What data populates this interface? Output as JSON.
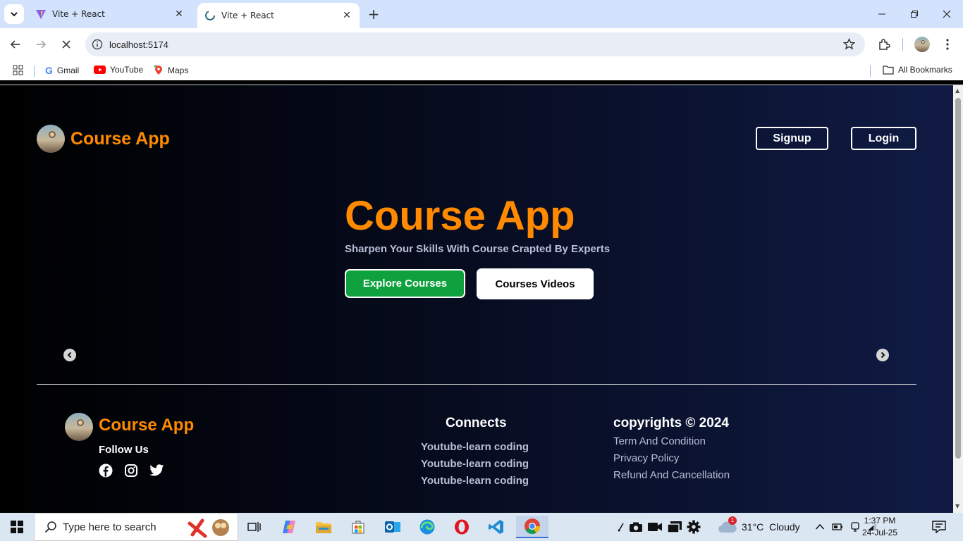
{
  "browser": {
    "tabs": [
      {
        "title": "Vite + React",
        "active": false
      },
      {
        "title": "Vite + React",
        "active": true
      }
    ],
    "url": "localhost:5174",
    "bookmarks": [
      {
        "label": "Gmail"
      },
      {
        "label": "YouTube"
      },
      {
        "label": "Maps"
      }
    ],
    "all_bookmarks": "All Bookmarks"
  },
  "header": {
    "brand": "Course App",
    "signup": "Signup",
    "login": "Login"
  },
  "hero": {
    "title": "Course App",
    "subtitle": "Sharpen Your Skills With Course Crapted By Experts",
    "explore_btn": "Explore Courses",
    "videos_btn": "Courses Videos"
  },
  "footer": {
    "brand": "Course App",
    "follow": "Follow Us",
    "connects": {
      "heading": "Connects",
      "links": [
        "Youtube-learn coding",
        "Youtube-learn coding",
        "Youtube-learn coding"
      ]
    },
    "legal": {
      "heading": "copyrights © 2024",
      "links": [
        "Term And Condition",
        "Privacy Policy",
        "Refund And Cancellation"
      ]
    }
  },
  "taskbar": {
    "search_placeholder": "Type here to search",
    "weather": "31°C  Cloudy",
    "weather_badge": "1",
    "time": "1:37 PM",
    "date": "24-Jul-25"
  },
  "colors": {
    "brand": "#ff8a00",
    "explore": "#0fa13d"
  }
}
